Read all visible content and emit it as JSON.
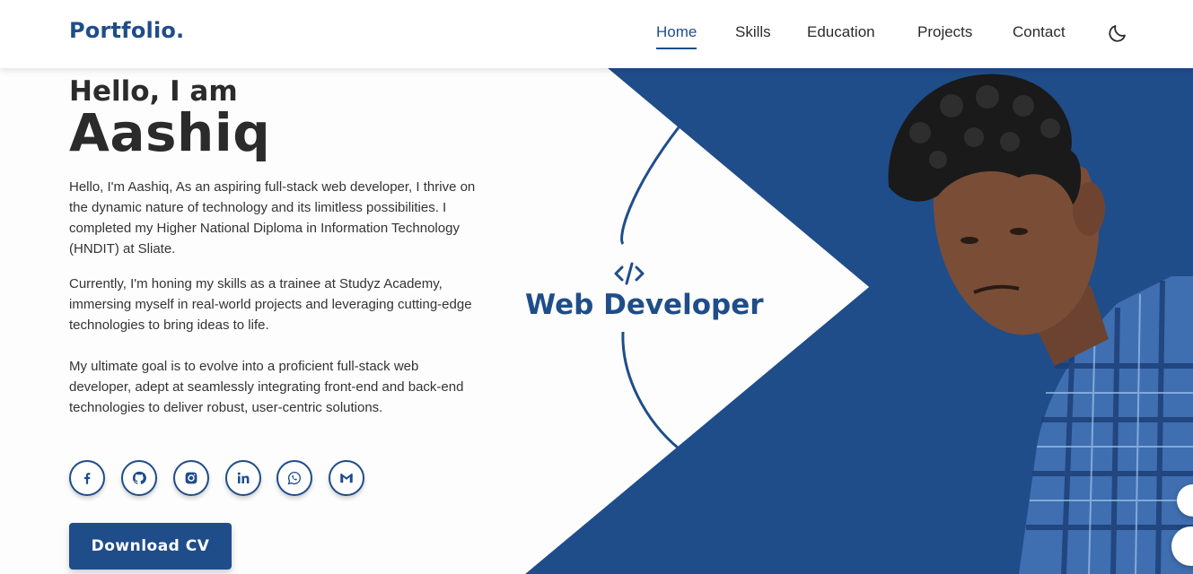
{
  "header": {
    "logo": "Portfolio.",
    "nav": [
      {
        "label": "Home",
        "active": true
      },
      {
        "label": "Skills",
        "active": false
      },
      {
        "label": "Education",
        "active": false
      },
      {
        "label": "Projects",
        "active": false
      },
      {
        "label": "Contact",
        "active": false
      }
    ],
    "theme_toggle_icon": "moon-icon"
  },
  "hero": {
    "greeting": "Hello, I am",
    "name": "Aashiq",
    "paragraphs": [
      "Hello, I'm Aashiq, As an aspiring full-stack web developer, I thrive on the dynamic nature of technology and its limitless possibilities. I completed my Higher National Diploma in Information Technology (HNDIT) at Sliate.",
      "Currently, I'm honing my skills as a trainee at Studyz Academy, immersing myself in real-world projects and leveraging cutting-edge technologies to bring ideas to life.",
      "My ultimate goal is to evolve into a proficient full-stack web developer, adept at seamlessly integrating front-end and back-end technologies to deliver robust, user-centric solutions."
    ],
    "socials": [
      "facebook-icon",
      "github-icon",
      "instagram-icon",
      "linkedin-icon",
      "whatsapp-icon",
      "gmail-icon"
    ],
    "cv_button": "Download CV",
    "role": "Web Developer",
    "role_icon": "code-icon"
  },
  "colors": {
    "accent": "#1f4d8a",
    "background": "#fdfdfd",
    "text": "#2b2b2b"
  }
}
